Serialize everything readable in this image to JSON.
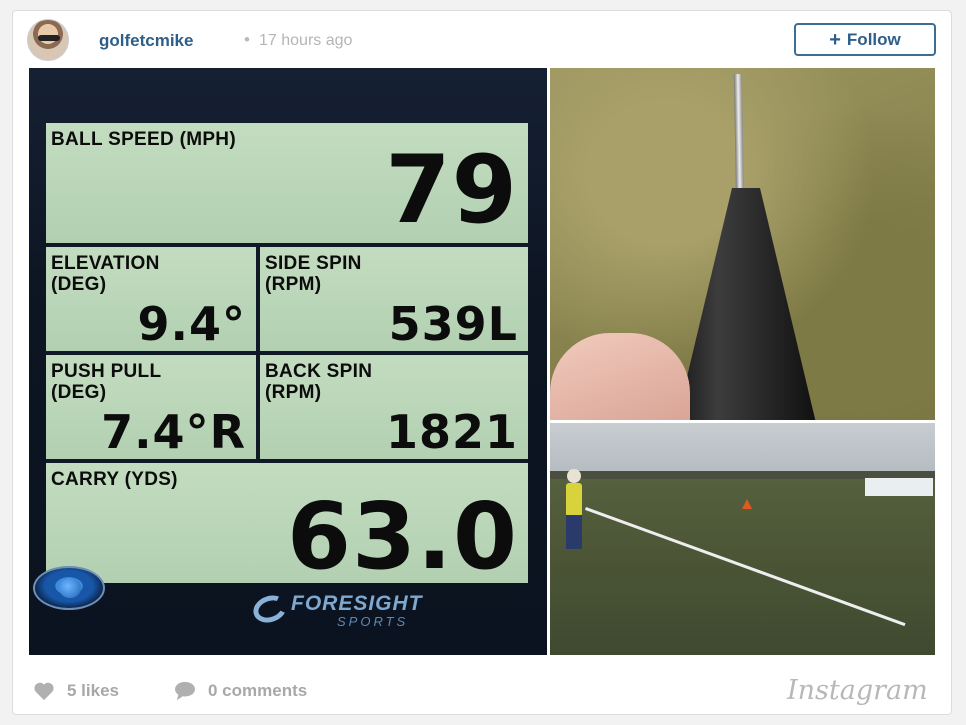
{
  "header": {
    "username": "golfetcmike",
    "separator": "•",
    "timestamp": "17 hours ago",
    "follow_label": "Follow",
    "follow_icon": "+"
  },
  "screen": {
    "ball_speed": {
      "label": "BALL SPEED (MPH)",
      "value": "79"
    },
    "elevation": {
      "label_line1": "ELEVATION",
      "label_line2": "(DEG)",
      "value": "9.4°"
    },
    "side_spin": {
      "label_line1": "SIDE SPIN",
      "label_line2": "(RPM)",
      "value": "539L"
    },
    "push_pull": {
      "label_line1": "PUSH PULL",
      "label_line2": "(DEG)",
      "value": "7.4°R"
    },
    "back_spin": {
      "label_line1": "BACK SPIN",
      "label_line2": "(RPM)",
      "value": "1821"
    },
    "carry": {
      "label": "CARRY (YDS)",
      "value": "63.0"
    },
    "brand_name": "FORESIGHT",
    "brand_sub": "SPORTS"
  },
  "footer": {
    "likes": "5 likes",
    "comments": "0 comments",
    "logo": "Instagram",
    "heart_icon": "heart-icon",
    "comment_icon": "comment-bubble-icon"
  },
  "colors": {
    "link": "#2d5f8a",
    "muted": "#a8a8a8",
    "lcd_panel": "#b8d4b6"
  }
}
